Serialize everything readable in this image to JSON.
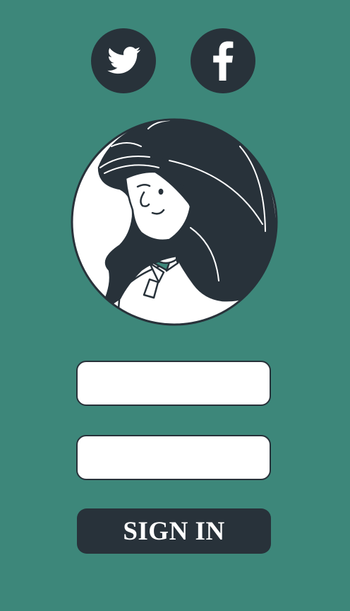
{
  "social": {
    "twitter_icon": "twitter-bird-icon",
    "facebook_icon": "facebook-f-icon"
  },
  "avatar": {
    "icon": "woman-portrait-illustration"
  },
  "form": {
    "username_value": "",
    "password_value": "",
    "signin_label": "SIGN IN"
  },
  "colors": {
    "background": "#3d877a",
    "dark": "#28323a",
    "field": "#ffffff",
    "accent": "#3d877a"
  }
}
